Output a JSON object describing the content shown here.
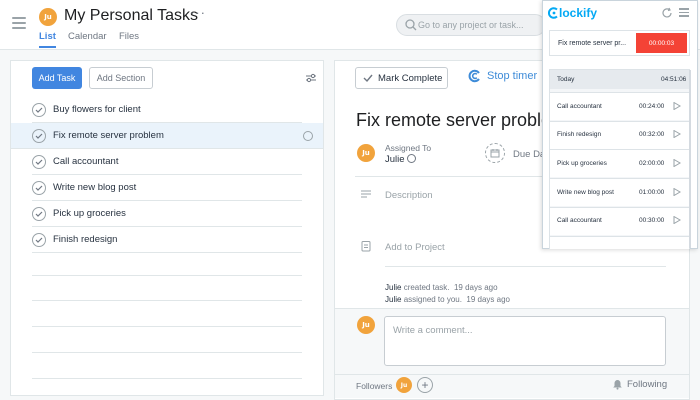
{
  "header": {
    "project_avatar": "Ju",
    "project_title": "My Personal Tasks",
    "more_glyph": "···",
    "tabs": [
      {
        "label": "List",
        "active": true
      },
      {
        "label": "Calendar",
        "active": false
      },
      {
        "label": "Files",
        "active": false
      }
    ],
    "search_placeholder": "Go to any project or task..."
  },
  "task_list": {
    "add_task_label": "Add Task",
    "add_section_label": "Add Section",
    "tasks": [
      {
        "name": "Buy flowers for client",
        "selected": false
      },
      {
        "name": "Fix remote server problem",
        "selected": true
      },
      {
        "name": "Call accountant",
        "selected": false
      },
      {
        "name": "Write new blog post",
        "selected": false
      },
      {
        "name": "Pick up groceries",
        "selected": false
      },
      {
        "name": "Finish redesign",
        "selected": false
      }
    ]
  },
  "detail": {
    "mark_complete_label": "Mark Complete",
    "stop_timer_label": "Stop timer",
    "title": "Fix remote server problem",
    "assigned_to_label": "Assigned To",
    "assignee_avatar": "Ju",
    "assignee_name": "Julie",
    "due_date_label": "Due Date",
    "description_placeholder": "Description",
    "add_to_project_label": "Add to Project",
    "stories": [
      {
        "actor": "Julie",
        "action": "created task.",
        "time": "19 days ago"
      },
      {
        "actor": "Julie",
        "action": "assigned to you.",
        "time": "19 days ago"
      }
    ],
    "comment_avatar": "Ju",
    "comment_placeholder": "Write a comment...",
    "followers_label": "Followers",
    "follower_avatar": "Ju",
    "add_follower_glyph": "+",
    "following_label": "Following"
  },
  "clockify": {
    "logo_text": "lockify",
    "running": {
      "description": "Fix remote server pr...",
      "time": "00:00:03"
    },
    "day_label": "Today",
    "day_total": "04:51:06",
    "entries": [
      {
        "description": "Call accountant",
        "time": "00:24:00"
      },
      {
        "description": "Finish redesign",
        "time": "00:32:00"
      },
      {
        "description": "Pick up groceries",
        "time": "02:00:00"
      },
      {
        "description": "Write new blog post",
        "time": "01:00:00"
      },
      {
        "description": "Call accountant",
        "time": "00:30:00"
      }
    ],
    "colors": {
      "brand": "#03a9f4",
      "stop": "#f44336"
    }
  },
  "colors": {
    "accent": "#4186e0",
    "avatar": "#f1a33c"
  }
}
